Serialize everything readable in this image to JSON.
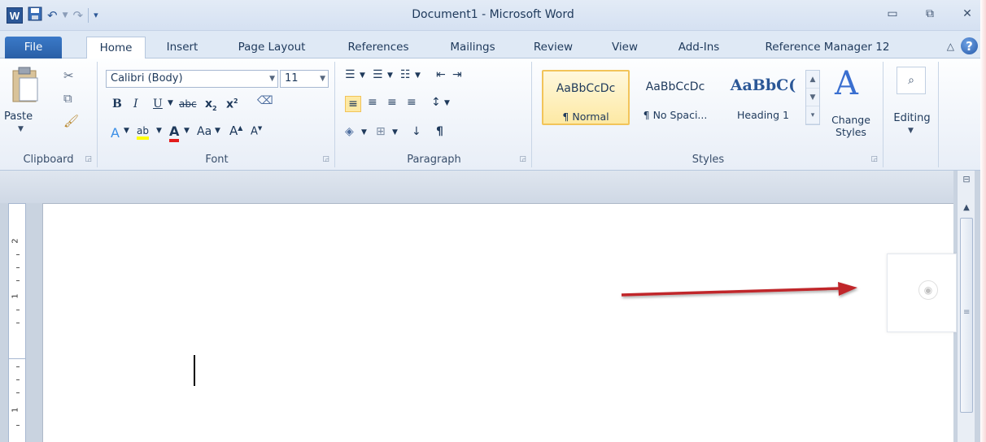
{
  "titlebar": {
    "title": "Document1  -  Microsoft Word",
    "app_logo": "W",
    "qat": {
      "save_icon": "save-icon",
      "undo_icon": "undo-icon",
      "redo_icon": "redo-icon",
      "customize_icon": "customize-qat-icon"
    },
    "window_controls": [
      "minimize",
      "restore",
      "close"
    ]
  },
  "tabs": [
    {
      "label": "File"
    },
    {
      "label": "Home"
    },
    {
      "label": "Insert"
    },
    {
      "label": "Page Layout"
    },
    {
      "label": "References"
    },
    {
      "label": "Mailings"
    },
    {
      "label": "Review"
    },
    {
      "label": "View"
    },
    {
      "label": "Add-Ins"
    },
    {
      "label": "Reference Manager 12"
    }
  ],
  "ribbon": {
    "clipboard": {
      "label": "Clipboard",
      "paste": "Paste"
    },
    "font": {
      "label": "Font",
      "family": "Calibri (Body)",
      "size": "11"
    },
    "paragraph": {
      "label": "Paragraph"
    },
    "styles": {
      "label": "Styles",
      "items": [
        {
          "sample": "AaBbCcDc",
          "name": "¶ Normal"
        },
        {
          "sample": "AaBbCcDc",
          "name": "¶ No Spaci..."
        },
        {
          "sample": "AaBbC(",
          "name": "Heading 1"
        }
      ],
      "change_styles": "Change\nStyles"
    },
    "editing": {
      "label": "Editing"
    }
  },
  "colors": {
    "accent": "#2b5797",
    "annotation_arrow": "#c0282c",
    "active_style": "#f2c45a"
  },
  "ruler": {
    "numbers": [
      "2",
      "1",
      "1"
    ]
  }
}
